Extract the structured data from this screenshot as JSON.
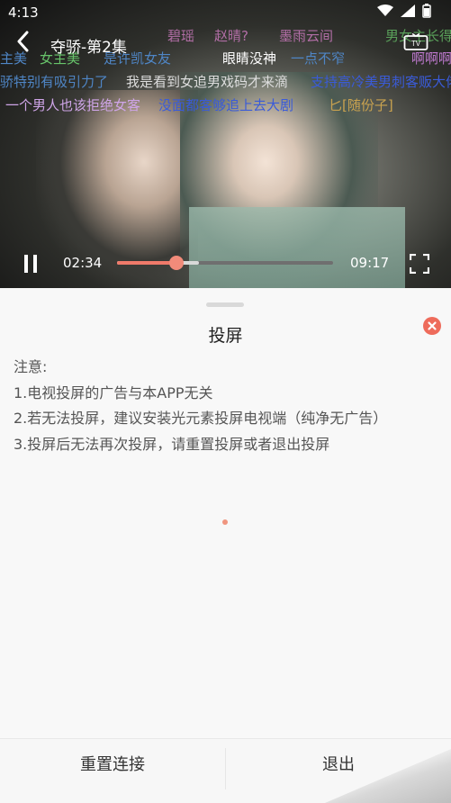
{
  "status_bar": {
    "time": "4:13"
  },
  "video": {
    "title": "夺骄-第2集",
    "current_time": "02:34",
    "total_time": "09:17",
    "progress_fraction": 0.277,
    "buffered_fraction": 0.38,
    "danmaku": [
      {
        "text": "碧瑶",
        "color": "#b26ea6"
      },
      {
        "text": "赵晴?",
        "color": "#b26ea6"
      },
      {
        "text": "墨雨云间",
        "color": "#b26ea6"
      },
      {
        "text": "男女主长得",
        "color": "#5aa05a"
      },
      {
        "text": "主美",
        "color": "#4f86c6"
      },
      {
        "text": "女主美",
        "color": "#67c36a"
      },
      {
        "text": "是许凯女友",
        "color": "#4f86c6"
      },
      {
        "text": "眼睛没神",
        "color": "#ffffff"
      },
      {
        "text": "一点不窄",
        "color": "#4f86c6"
      },
      {
        "text": "啊啊啊",
        "color": "#c07ad0"
      },
      {
        "text": "骄特别有吸引力了",
        "color": "#4f86c6"
      },
      {
        "text": "我是看到女追男戏码才来滴",
        "color": "#dddddd"
      },
      {
        "text": "支持高冷美男刺客贩大佬",
        "color": "#3a5bd8"
      },
      {
        "text": "一个男人也该拒绝女客",
        "color": "#cfa5e8"
      },
      {
        "text": "没面都客够追上去大剧",
        "color": "#3a5bd8"
      },
      {
        "text": "匕[随份子]",
        "color": "#c9a24f"
      }
    ]
  },
  "sheet": {
    "title": "投屏",
    "notes": [
      "注意:",
      "1.电视投屏的广告与本APP无关",
      "2.若无法投屏，建议安装光元素投屏电视端（纯净无广告）",
      "3.投屏后无法再次投屏，请重置投屏或者退出投屏"
    ],
    "reset_label": "重置连接",
    "exit_label": "退出"
  },
  "colors": {
    "accent": "#ee6b5b",
    "progress": "#f07a6a"
  }
}
